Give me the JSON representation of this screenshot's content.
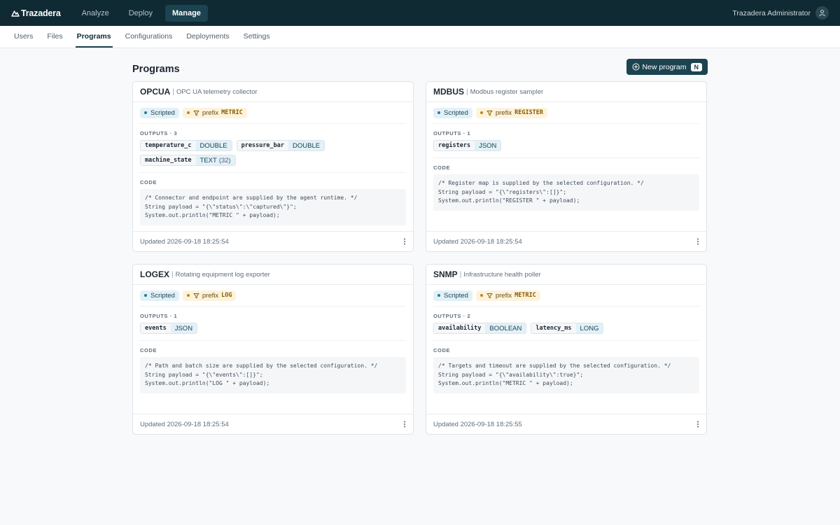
{
  "brand": {
    "name": "Trazadera"
  },
  "topnav": [
    {
      "label": "Analyze",
      "active": false
    },
    {
      "label": "Deploy",
      "active": false
    },
    {
      "label": "Manage",
      "active": true
    }
  ],
  "user": {
    "name": "Trazadera Administrator"
  },
  "subnav": [
    {
      "label": "Users",
      "active": false
    },
    {
      "label": "Files",
      "active": false
    },
    {
      "label": "Programs",
      "active": true
    },
    {
      "label": "Configurations",
      "active": false
    },
    {
      "label": "Deployments",
      "active": false
    },
    {
      "label": "Settings",
      "active": false
    }
  ],
  "page": {
    "title": "Programs",
    "new_button": "New program",
    "new_button_kbd": "N"
  },
  "labels": {
    "outputs": "OUTPUTS",
    "code": "CODE",
    "scripted": "Scripted",
    "prefix": "prefix",
    "updated": "Updated"
  },
  "programs": [
    {
      "name": "OPCUA",
      "description": "OPC UA telemetry collector",
      "prefix": "METRIC",
      "outputs_count": "3",
      "outputs": [
        {
          "name": "temperature_c",
          "type": "DOUBLE",
          "size": ""
        },
        {
          "name": "pressure_bar",
          "type": "DOUBLE",
          "size": ""
        },
        {
          "name": "machine_state",
          "type": "TEXT",
          "size": "(32)"
        }
      ],
      "code": "/* Connector and endpoint are supplied by the agent runtime. */\nString payload = \"{\\\"status\\\":\\\"captured\\\"}\";\nSystem.out.println(\"METRIC \" + payload);",
      "updated": "2026-09-18 18:25:54"
    },
    {
      "name": "MDBUS",
      "description": "Modbus register sampler",
      "prefix": "REGISTER",
      "outputs_count": "1",
      "outputs": [
        {
          "name": "registers",
          "type": "JSON",
          "size": ""
        }
      ],
      "code": "/* Register map is supplied by the selected configuration. */\nString payload = \"{\\\"registers\\\":[]}\";\nSystem.out.println(\"REGISTER \" + payload);",
      "updated": "2026-09-18 18:25:54"
    },
    {
      "name": "LOGEX",
      "description": "Rotating equipment log exporter",
      "prefix": "LOG",
      "outputs_count": "1",
      "outputs": [
        {
          "name": "events",
          "type": "JSON",
          "size": ""
        }
      ],
      "code": "/* Path and batch size are supplied by the selected configuration. */\nString payload = \"{\\\"events\\\":[]}\";\nSystem.out.println(\"LOG \" + payload);",
      "updated": "2026-09-18 18:25:54"
    },
    {
      "name": "SNMP",
      "description": "Infrastructure health poller",
      "prefix": "METRIC",
      "outputs_count": "2",
      "outputs": [
        {
          "name": "availability",
          "type": "BOOLEAN",
          "size": ""
        },
        {
          "name": "latency_ms",
          "type": "LONG",
          "size": ""
        }
      ],
      "code": "/* Targets and timeout are supplied by the selected configuration. */\nString payload = \"{\\\"availability\\\":true}\";\nSystem.out.println(\"METRIC \" + payload);",
      "updated": "2026-09-18 18:25:55"
    }
  ],
  "icons": {
    "brand": "brand-logo-icon",
    "avatar": "user-icon",
    "new": "plus-circle-icon",
    "filter": "filter-icon",
    "more": "kebab-menu-icon"
  },
  "colors": {
    "topbar": "#0f2a33",
    "accent": "#1c4350",
    "scripted_bg": "#e2f1f8",
    "prefix_bg": "#fdf3dc"
  }
}
